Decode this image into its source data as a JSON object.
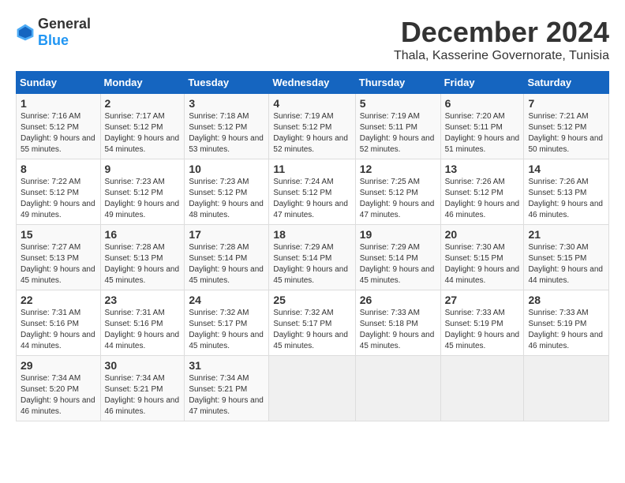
{
  "logo": {
    "text_general": "General",
    "text_blue": "Blue"
  },
  "header": {
    "month_year": "December 2024",
    "location": "Thala, Kasserine Governorate, Tunisia"
  },
  "weekdays": [
    "Sunday",
    "Monday",
    "Tuesday",
    "Wednesday",
    "Thursday",
    "Friday",
    "Saturday"
  ],
  "weeks": [
    [
      {
        "day": "1",
        "sunrise": "7:16 AM",
        "sunset": "5:12 PM",
        "daylight": "9 hours and 55 minutes."
      },
      {
        "day": "2",
        "sunrise": "7:17 AM",
        "sunset": "5:12 PM",
        "daylight": "9 hours and 54 minutes."
      },
      {
        "day": "3",
        "sunrise": "7:18 AM",
        "sunset": "5:12 PM",
        "daylight": "9 hours and 53 minutes."
      },
      {
        "day": "4",
        "sunrise": "7:19 AM",
        "sunset": "5:12 PM",
        "daylight": "9 hours and 52 minutes."
      },
      {
        "day": "5",
        "sunrise": "7:19 AM",
        "sunset": "5:11 PM",
        "daylight": "9 hours and 52 minutes."
      },
      {
        "day": "6",
        "sunrise": "7:20 AM",
        "sunset": "5:11 PM",
        "daylight": "9 hours and 51 minutes."
      },
      {
        "day": "7",
        "sunrise": "7:21 AM",
        "sunset": "5:12 PM",
        "daylight": "9 hours and 50 minutes."
      }
    ],
    [
      {
        "day": "8",
        "sunrise": "7:22 AM",
        "sunset": "5:12 PM",
        "daylight": "9 hours and 49 minutes."
      },
      {
        "day": "9",
        "sunrise": "7:23 AM",
        "sunset": "5:12 PM",
        "daylight": "9 hours and 49 minutes."
      },
      {
        "day": "10",
        "sunrise": "7:23 AM",
        "sunset": "5:12 PM",
        "daylight": "9 hours and 48 minutes."
      },
      {
        "day": "11",
        "sunrise": "7:24 AM",
        "sunset": "5:12 PM",
        "daylight": "9 hours and 47 minutes."
      },
      {
        "day": "12",
        "sunrise": "7:25 AM",
        "sunset": "5:12 PM",
        "daylight": "9 hours and 47 minutes."
      },
      {
        "day": "13",
        "sunrise": "7:26 AM",
        "sunset": "5:12 PM",
        "daylight": "9 hours and 46 minutes."
      },
      {
        "day": "14",
        "sunrise": "7:26 AM",
        "sunset": "5:13 PM",
        "daylight": "9 hours and 46 minutes."
      }
    ],
    [
      {
        "day": "15",
        "sunrise": "7:27 AM",
        "sunset": "5:13 PM",
        "daylight": "9 hours and 45 minutes."
      },
      {
        "day": "16",
        "sunrise": "7:28 AM",
        "sunset": "5:13 PM",
        "daylight": "9 hours and 45 minutes."
      },
      {
        "day": "17",
        "sunrise": "7:28 AM",
        "sunset": "5:14 PM",
        "daylight": "9 hours and 45 minutes."
      },
      {
        "day": "18",
        "sunrise": "7:29 AM",
        "sunset": "5:14 PM",
        "daylight": "9 hours and 45 minutes."
      },
      {
        "day": "19",
        "sunrise": "7:29 AM",
        "sunset": "5:14 PM",
        "daylight": "9 hours and 45 minutes."
      },
      {
        "day": "20",
        "sunrise": "7:30 AM",
        "sunset": "5:15 PM",
        "daylight": "9 hours and 44 minutes."
      },
      {
        "day": "21",
        "sunrise": "7:30 AM",
        "sunset": "5:15 PM",
        "daylight": "9 hours and 44 minutes."
      }
    ],
    [
      {
        "day": "22",
        "sunrise": "7:31 AM",
        "sunset": "5:16 PM",
        "daylight": "9 hours and 44 minutes."
      },
      {
        "day": "23",
        "sunrise": "7:31 AM",
        "sunset": "5:16 PM",
        "daylight": "9 hours and 44 minutes."
      },
      {
        "day": "24",
        "sunrise": "7:32 AM",
        "sunset": "5:17 PM",
        "daylight": "9 hours and 45 minutes."
      },
      {
        "day": "25",
        "sunrise": "7:32 AM",
        "sunset": "5:17 PM",
        "daylight": "9 hours and 45 minutes."
      },
      {
        "day": "26",
        "sunrise": "7:33 AM",
        "sunset": "5:18 PM",
        "daylight": "9 hours and 45 minutes."
      },
      {
        "day": "27",
        "sunrise": "7:33 AM",
        "sunset": "5:19 PM",
        "daylight": "9 hours and 45 minutes."
      },
      {
        "day": "28",
        "sunrise": "7:33 AM",
        "sunset": "5:19 PM",
        "daylight": "9 hours and 46 minutes."
      }
    ],
    [
      {
        "day": "29",
        "sunrise": "7:34 AM",
        "sunset": "5:20 PM",
        "daylight": "9 hours and 46 minutes."
      },
      {
        "day": "30",
        "sunrise": "7:34 AM",
        "sunset": "5:21 PM",
        "daylight": "9 hours and 46 minutes."
      },
      {
        "day": "31",
        "sunrise": "7:34 AM",
        "sunset": "5:21 PM",
        "daylight": "9 hours and 47 minutes."
      },
      null,
      null,
      null,
      null
    ]
  ]
}
